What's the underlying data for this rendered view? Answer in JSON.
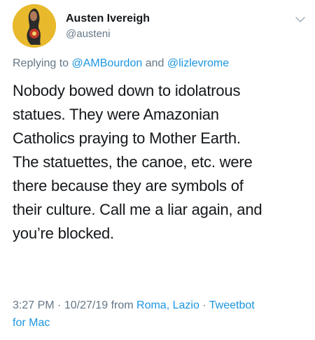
{
  "author": {
    "name": "Austen Ivereigh",
    "handle": "@austeni",
    "avatar_icon": "avatar-painting-icon"
  },
  "reply": {
    "prefix": "Replying to",
    "user1": "@AMBourdon",
    "conj": "and",
    "user2": "@lizlevrome"
  },
  "tweet": {
    "lines": [
      "Nobody bowed down to idolatrous",
      "statues. They were Amazonian",
      "Catholics praying to Mother Earth.",
      "The statuettes, the canoe, etc. were",
      "there because they are symbols of",
      "their culture. Call me a liar again, and",
      "you’re blocked."
    ]
  },
  "meta": {
    "time": "3:27 PM",
    "sep1": "·",
    "date": "10/27/19",
    "from": "from",
    "location": "Roma, Lazio",
    "sep2": "·",
    "client_line1": "Tweetbot",
    "client_line2": "for Mac"
  },
  "colors": {
    "link": "#1b95e0",
    "muted": "#657786",
    "text": "#14171a",
    "avatar_bg": "#e8b92c"
  }
}
